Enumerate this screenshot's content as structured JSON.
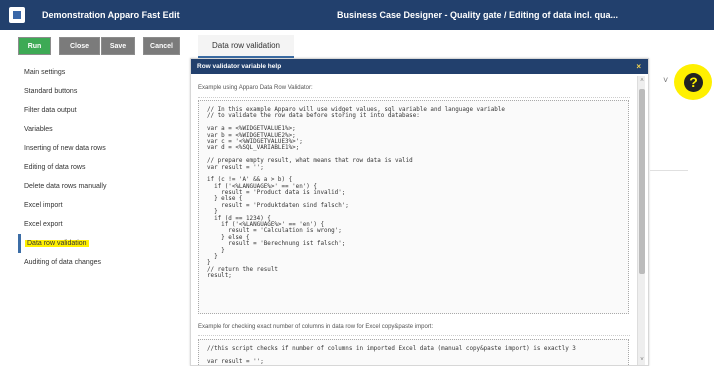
{
  "app": {
    "name": "Demonstration Apparo Fast Edit",
    "window_title": "Business Case Designer - Quality gate / Editing of data incl. qua..."
  },
  "toolbar": {
    "run": "Run",
    "close": "Close",
    "save": "Save",
    "cancel": "Cancel"
  },
  "tab": {
    "label": "Data row validation"
  },
  "sidebar": {
    "items": [
      {
        "label": "Main settings"
      },
      {
        "label": "Standard buttons"
      },
      {
        "label": "Filter data output"
      },
      {
        "label": "Variables"
      },
      {
        "label": "Inserting of new data rows"
      },
      {
        "label": "Editing of data rows"
      },
      {
        "label": "Delete data rows manually"
      },
      {
        "label": "Excel import"
      },
      {
        "label": "Excel export"
      },
      {
        "label": "Data row validation"
      },
      {
        "label": "Auditing of data changes"
      }
    ]
  },
  "modal": {
    "title": "Row validator variable help",
    "close_symbol": "×",
    "intro": "Example using Apparo Data Row Validator:",
    "example1_lines": [
      "// In this example Apparo will use widget values, sql variable and language variable",
      "// to validate the row data before storing it into database:",
      "",
      "var a = <%WIDGETVALUE1%>;",
      "var b = <%WIDGETVALUE2%>;",
      "var c = '<%WIDGETVALUE3%>';",
      "var d = <%SQL_VARIABLE1%>;",
      "",
      "// prepare empty result, what means that row data is valid",
      "var result = '';",
      "",
      "if (c != 'A' && a > b) {",
      "  if ('<%LANGUAGE%>' == 'en') {",
      "    result = 'Product data is invalid';",
      "  } else {",
      "    result = 'Produktdaten sind falsch';",
      "  }",
      "  if (d == 1234) {",
      "    if ('<%LANGUAGE%>' == 'en') {",
      "      result = 'Calculation is wrong';",
      "    } else {",
      "      result = 'Berechnung ist falsch';",
      "    }",
      "  }",
      "}",
      "// return the result",
      "result;"
    ],
    "section2_intro": "Example for checking exact number of columns in data row for Excel copy&paste import:",
    "example2_lines": [
      "//this script checks if number of columns in imported Excel data (manual copy&paste import) is exactly 3",
      "",
      "var result = '';"
    ],
    "scroll_up_icon": "scroll-up-arrow",
    "scroll_down_icon": "scroll-down-arrow"
  },
  "help": {
    "symbol": "?",
    "chevron": "˅"
  },
  "colors": {
    "header": "#22406d",
    "run_button": "#3daa55",
    "gray_button": "#7b7b7b",
    "highlight": "#fff000"
  }
}
